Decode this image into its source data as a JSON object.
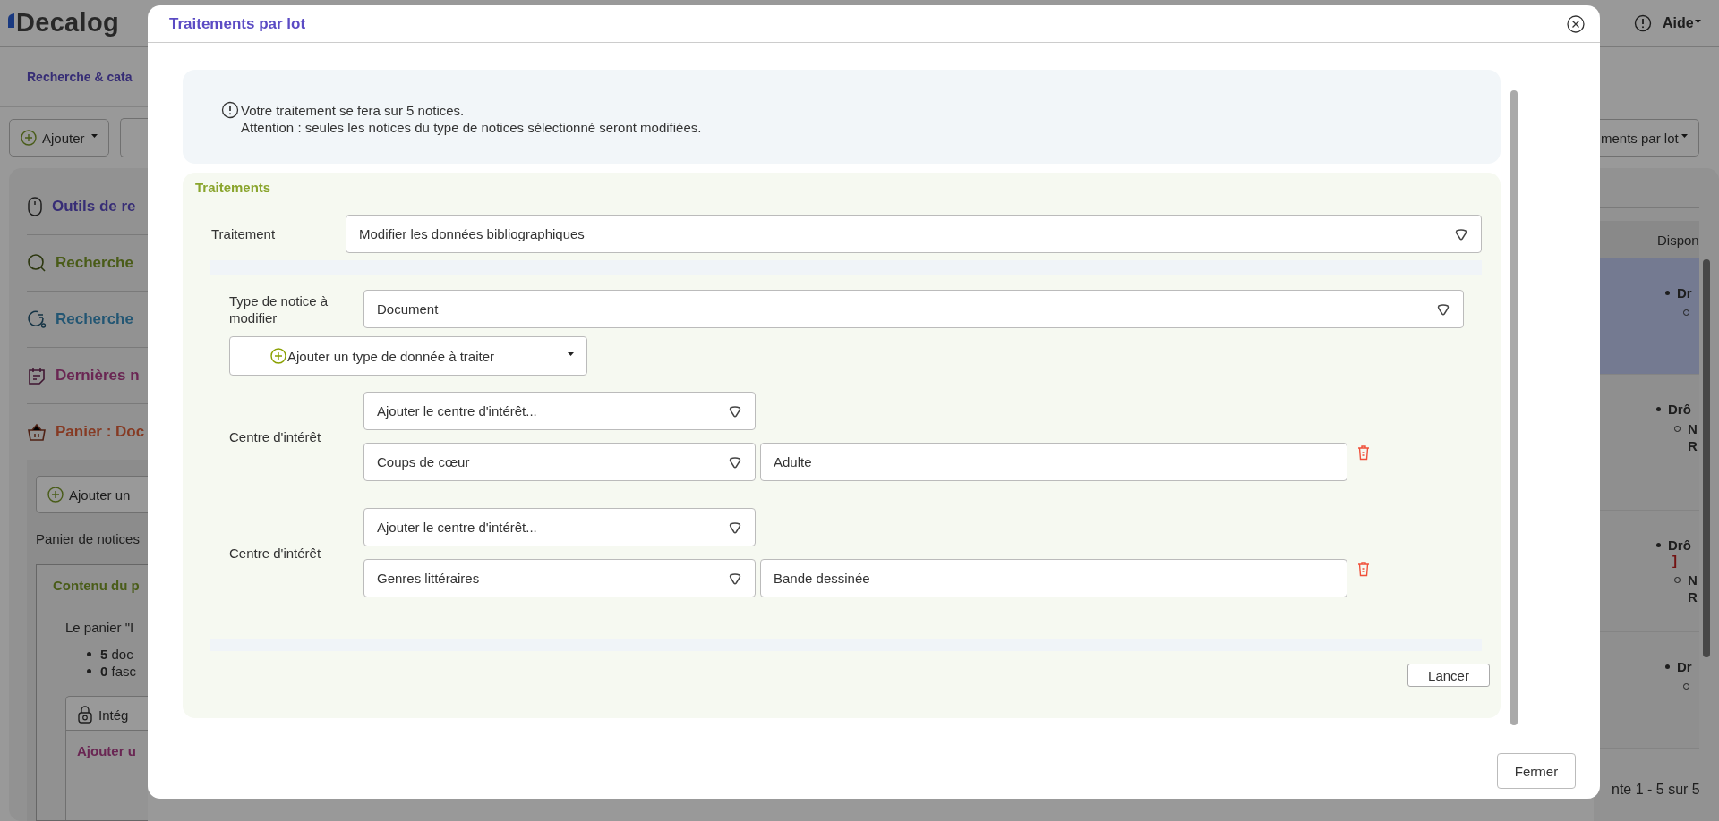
{
  "app": {
    "logo": "Decalog",
    "breadcrumb": "Recherche & cata",
    "add_button": "Ajouter",
    "help": "Aide",
    "batch_button": "ments par lot",
    "sidebar_items": [
      {
        "label": "Outils de re",
        "kind": "mouse",
        "color": "#372d76"
      },
      {
        "label": "Recherche",
        "kind": "search",
        "color": "#4a5c19"
      },
      {
        "label": "Recherche",
        "kind": "history",
        "color": "#235673"
      },
      {
        "label": "Dernières n",
        "kind": "note",
        "color": "#6a2653"
      },
      {
        "label": "Panier : Doc",
        "kind": "basket",
        "color": "#863a23"
      }
    ],
    "basket": {
      "add_button": "Ajouter un",
      "caption": "Panier de notices",
      "content_title": "Contenu du p",
      "summary": "Le panier \"I",
      "counts": [
        {
          "count": "5",
          "label": "doc"
        },
        {
          "count": "0",
          "label": "fasc"
        }
      ],
      "integrate_button": "Intég",
      "add_section": "Ajouter u"
    },
    "table": {
      "column": "Dispon",
      "rows": [
        {
          "selected": true,
          "title": "Dr"
        },
        {
          "selected": false,
          "title": "Drô",
          "sub": [
            "N",
            "R"
          ]
        },
        {
          "selected": false,
          "title": "Drô",
          "note": "]",
          "sub": [
            "N",
            "R"
          ]
        },
        {
          "selected": false,
          "title": "Dr"
        }
      ]
    },
    "pagination": "nte 1 - 5 sur 5"
  },
  "dialog": {
    "title": "Traitements par lot",
    "info": [
      "Votre traitement se fera sur 5 notices.",
      "Attention : seules les notices du type de notices sélectionné seront modifiées."
    ],
    "section_title": "Traitements",
    "treatment": {
      "label": "Traitement",
      "value": "Modifier les données bibliographiques"
    },
    "record_type": {
      "label": "Type de notice à modifier",
      "value": "Document"
    },
    "add_type_button": "Ajouter un type de donnée à traiter",
    "groups": [
      {
        "label": "Centre d'intérêt",
        "add_select": "Ajouter le centre d'intérêt...",
        "entries": [
          {
            "category": "Coups de cœur",
            "value": "Adulte"
          }
        ]
      },
      {
        "label": "Centre d'intérêt",
        "add_select": "Ajouter le centre d'intérêt...",
        "entries": [
          {
            "category": "Genres littéraires",
            "value": "Bande dessinée"
          }
        ]
      }
    ],
    "launch_button": "Lancer",
    "close_button": "Fermer"
  }
}
